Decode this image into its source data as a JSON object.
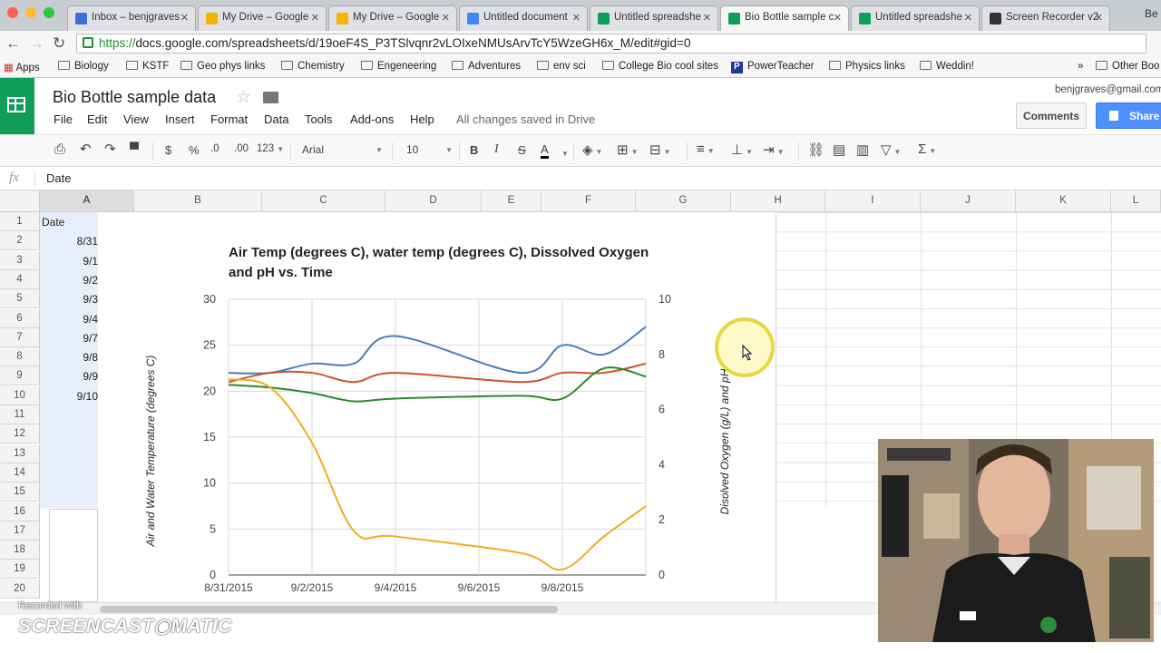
{
  "browser": {
    "tabs": [
      {
        "label": "Inbox – benjgraves",
        "icon_color": "#3d6fd8"
      },
      {
        "label": "My Drive – Google",
        "icon_color": "#f4b400"
      },
      {
        "label": "My Drive – Google",
        "icon_color": "#f4b400"
      },
      {
        "label": "Untitled document",
        "icon_color": "#4285f4"
      },
      {
        "label": "Untitled spreadshe",
        "icon_color": "#0f9d58"
      },
      {
        "label": "Bio Bottle sample c",
        "icon_color": "#0f9d58"
      },
      {
        "label": "Untitled spreadshe",
        "icon_color": "#0f9d58"
      },
      {
        "label": "Screen Recorder v2",
        "icon_color": "#333333"
      }
    ],
    "tab_overflow": "Be",
    "url_scheme": "https://",
    "url_rest": "docs.google.com/spreadsheets/d/19oeF4S_P3TSlvqnr2vLOIxeNMUsArvTcY5WzeGH6x_M/edit#gid=0",
    "bookmarks": [
      "Apps",
      "Biology",
      "KSTF",
      "Geo phys links",
      "Chemistry",
      "Engeneering",
      "Adventures",
      "env sci",
      "College Bio cool sites",
      "PowerTeacher",
      "Physics links",
      "Weddin!"
    ],
    "bookmarks_more": "»",
    "other_bookmarks": "Other Boo"
  },
  "sheets": {
    "title": "Bio Bottle sample data",
    "menu": [
      "File",
      "Edit",
      "View",
      "Insert",
      "Format",
      "Data",
      "Tools",
      "Add-ons",
      "Help"
    ],
    "save_status": "All changes saved in Drive",
    "user_email": "benjgraves@gmail.com",
    "comments_label": "Comments",
    "share_label": "Share",
    "toolbar": {
      "currency": "$",
      "percent": "%",
      "dec_less": ".0",
      "dec_more": ".00",
      "more_formats": "123",
      "font": "Arial",
      "font_size": "10",
      "bold": "B",
      "italic": "I",
      "strike": "S",
      "text_color": "A",
      "sum": "Σ"
    },
    "formula_bar": {
      "fx": "fx",
      "value": "Date"
    },
    "columns": [
      "A",
      "B",
      "C",
      "D",
      "E",
      "F",
      "G",
      "H",
      "I",
      "J",
      "K",
      "L"
    ],
    "rows": [
      "1",
      "2",
      "3",
      "4",
      "5",
      "6",
      "7",
      "8",
      "9",
      "10",
      "11",
      "12",
      "13",
      "14",
      "15",
      "16",
      "17",
      "18",
      "19",
      "20"
    ],
    "col_a_values": [
      "Date",
      "8/31",
      "9/1",
      "9/2",
      "9/3",
      "9/4",
      "9/7",
      "9/8",
      "9/9",
      "9/10"
    ]
  },
  "chart_data": {
    "type": "line",
    "title": "Air Temp (degrees C), water temp (degrees C), Dissolved Oxygen and pH vs. Time",
    "ylabel": "Air and Water Temperature (degrees C)",
    "y2label": "Disolved Oxygen (g/L) and pH",
    "ylim": [
      0,
      30
    ],
    "y2lim": [
      0,
      10
    ],
    "yticks": [
      "0",
      "5",
      "10",
      "15",
      "20",
      "25",
      "30"
    ],
    "y2ticks": [
      "0",
      "2",
      "4",
      "6",
      "8",
      "10"
    ],
    "xticks": [
      "8/31/2015",
      "9/2/2015",
      "9/4/2015",
      "9/6/2015",
      "9/8/2015"
    ],
    "xlim": [
      "8/31/2015",
      "9/10/2015"
    ],
    "grid": true,
    "series": [
      {
        "color": "#4a7ebb",
        "axis": "left",
        "x": [
          "8/31/2015",
          "9/1/2015",
          "9/2/2015",
          "9/3/2015",
          "9/4/2015",
          "9/7/2015",
          "9/8/2015",
          "9/9/2015",
          "9/10/2015"
        ],
        "values": [
          22,
          22,
          23,
          23,
          26,
          22,
          25,
          24,
          27
        ]
      },
      {
        "color": "#d0502e",
        "axis": "left",
        "x": [
          "8/31/2015",
          "9/1/2015",
          "9/2/2015",
          "9/3/2015",
          "9/4/2015",
          "9/7/2015",
          "9/8/2015",
          "9/9/2015",
          "9/10/2015"
        ],
        "values": [
          21,
          22,
          22,
          21,
          22,
          21,
          22,
          22,
          23
        ]
      },
      {
        "color": "#2b8a2b",
        "axis": "right",
        "x": [
          "8/31/2015",
          "9/1/2015",
          "9/2/2015",
          "9/3/2015",
          "9/4/2015",
          "9/7/2015",
          "9/8/2015",
          "9/9/2015",
          "9/10/2015"
        ],
        "values": [
          6.9,
          6.8,
          6.6,
          6.3,
          6.4,
          6.5,
          6.4,
          7.5,
          7.2
        ]
      },
      {
        "color": "#f0ab1e",
        "axis": "right",
        "x": [
          "8/31/2015",
          "9/1/2015",
          "9/2/2015",
          "9/3/2015",
          "9/4/2015",
          "9/7/2015",
          "9/8/2015",
          "9/9/2015",
          "9/10/2015"
        ],
        "values": [
          7.1,
          6.8,
          4.8,
          1.6,
          1.4,
          0.8,
          0.2,
          1.4,
          2.5
        ]
      }
    ]
  },
  "watermark": {
    "small": "Recorded with",
    "big": "SCREENCAST◉MATIC"
  }
}
